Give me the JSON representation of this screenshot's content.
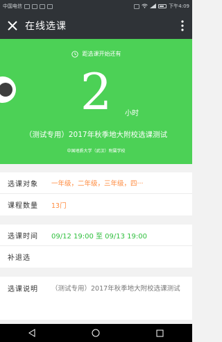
{
  "status_bar": {
    "left_text": "中国电信",
    "time": "下午4:09"
  },
  "header": {
    "title": "在线选课"
  },
  "hero": {
    "countdown_label": "距选课开始还有",
    "countdown_value": "2",
    "countdown_unit": "小时",
    "exam_title": "（测试专用）2017年秋季地大附校选课测试",
    "school": "中国地质大学（武汉）附属学校"
  },
  "info": {
    "target_label": "选课对象",
    "target_value": "一年级，二年级，三年级，四···",
    "count_label": "课程数量",
    "count_value": "13门",
    "time_label": "选课时间",
    "time_value": "09/12 19:00 至 09/13 19:00",
    "makeup_label": "补退选",
    "makeup_value": "",
    "desc_label": "选课说明",
    "desc_value": "（测试专用）2017年秋季地大附校选课测试"
  },
  "colors": {
    "accent_green": "#4cd156",
    "orange": "#ff8a3d",
    "dark_bar": "#2f3337"
  },
  "icons": [
    "close-icon",
    "more-vertical-icon",
    "clock-icon",
    "back-nav-icon",
    "home-nav-icon",
    "recents-nav-icon"
  ]
}
